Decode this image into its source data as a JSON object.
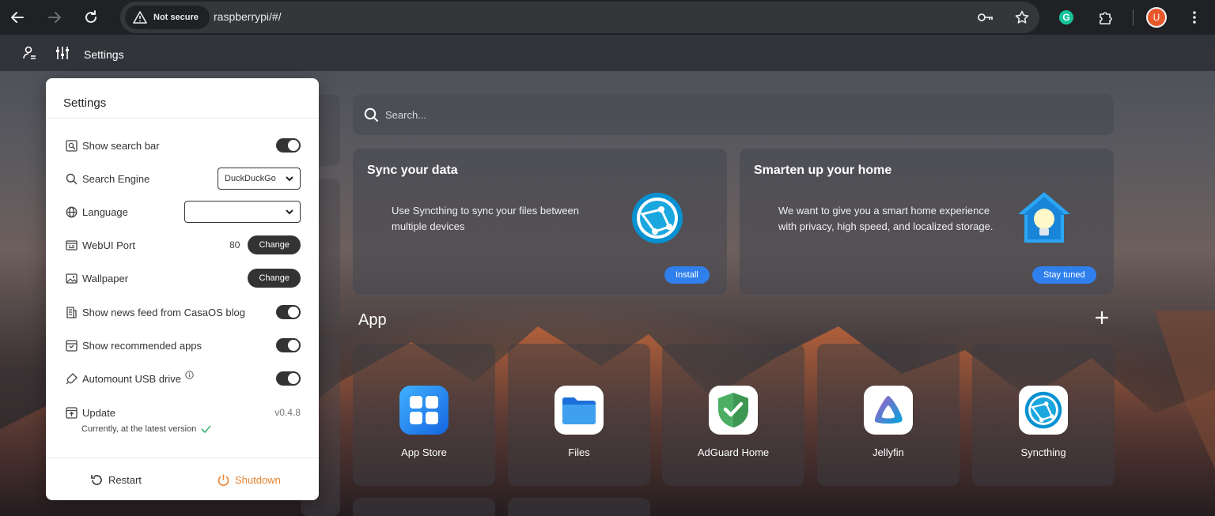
{
  "browser": {
    "security_label": "Not secure",
    "url": "raspberrypi/#/",
    "profile_initial": "U",
    "extension_initial": "G"
  },
  "topbar": {
    "settings_label": "Settings"
  },
  "settings": {
    "title": "Settings",
    "items": [
      {
        "label": "Show search bar",
        "icon": "search-box-icon",
        "control": "toggle",
        "on": true
      },
      {
        "label": "Search Engine",
        "icon": "search-icon",
        "control": "select",
        "value": "DuckDuckGo"
      },
      {
        "label": "Language",
        "icon": "globe-icon",
        "control": "select",
        "value": ""
      },
      {
        "label": "WebUI Port",
        "icon": "port-icon",
        "control": "button",
        "value": "80",
        "button": "Change"
      },
      {
        "label": "Wallpaper",
        "icon": "image-icon",
        "control": "button",
        "button": "Change"
      },
      {
        "label": "Show news feed from CasaOS blog",
        "icon": "news-icon",
        "control": "toggle",
        "on": true
      },
      {
        "label": "Show recommended apps",
        "icon": "recommend-icon",
        "control": "toggle",
        "on": true
      },
      {
        "label": "Automount USB drive",
        "icon": "usb-icon",
        "control": "toggle",
        "on": true
      },
      {
        "label": "Update",
        "icon": "update-icon",
        "control": "text",
        "value": "v0.4.8"
      }
    ],
    "update_note": "Currently, at the latest version",
    "restart_label": "Restart",
    "shutdown_label": "Shutdown"
  },
  "search": {
    "placeholder": "Search..."
  },
  "promos": [
    {
      "title": "Sync your data",
      "text": "Use Syncthing to sync your files between multiple devices",
      "button": "Install"
    },
    {
      "title": "Smarten up your home",
      "text": "We want to give you a smart home experience with privacy, high speed, and localized storage.",
      "button": "Stay tuned"
    }
  ],
  "apps_section": {
    "title": "App",
    "apps": [
      {
        "name": "App Store",
        "icon": "app-store-icon"
      },
      {
        "name": "Files",
        "icon": "folder-icon"
      },
      {
        "name": "AdGuard Home",
        "icon": "adguard-shield-icon"
      },
      {
        "name": "Jellyfin",
        "icon": "jellyfin-icon"
      },
      {
        "name": "Syncthing",
        "icon": "syncthing-icon"
      }
    ]
  },
  "colors": {
    "accent_blue": "#2f80ed",
    "shutdown_orange": "#e8822e",
    "check_green": "#3cb371"
  }
}
